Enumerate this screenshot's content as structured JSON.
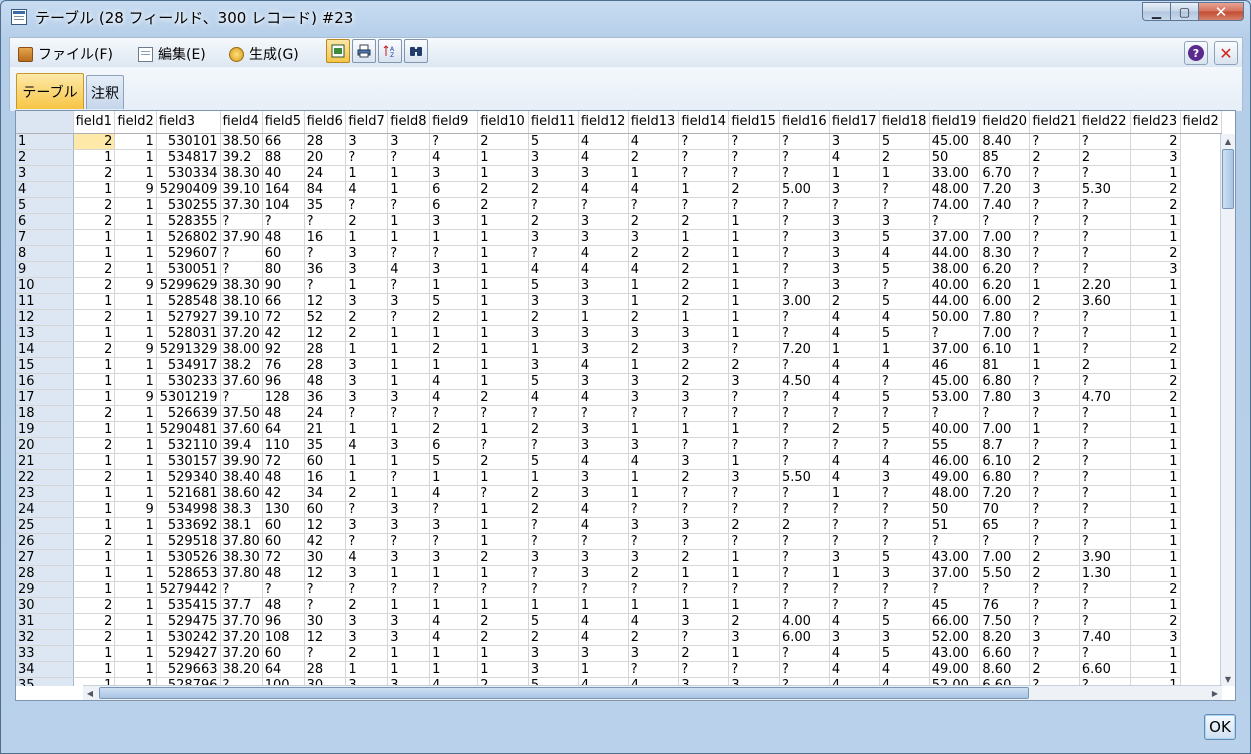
{
  "window": {
    "title": "テーブル (28 フィールド、300 レコード) #23"
  },
  "menu": [
    {
      "label": "ファイル(F)",
      "icon": "folder-icon"
    },
    {
      "label": "編集(E)",
      "icon": "edit-icon"
    },
    {
      "label": "生成(G)",
      "icon": "generate-icon"
    }
  ],
  "tabs": [
    {
      "label": "テーブル",
      "active": true
    },
    {
      "label": "注釈",
      "active": false
    }
  ],
  "columns": [
    "field1",
    "field2",
    "field3",
    "field4",
    "field5",
    "field6",
    "field7",
    "field8",
    "field9",
    "field10",
    "field11",
    "field12",
    "field13",
    "field14",
    "field15",
    "field16",
    "field17",
    "field18",
    "field19",
    "field20",
    "field21",
    "field22",
    "field23",
    "field2"
  ],
  "rows": [
    [
      "1",
      "2",
      "1",
      "530101",
      "38.50",
      "66",
      "28",
      "3",
      "3",
      "?",
      "2",
      "5",
      "4",
      "4",
      "?",
      "?",
      "?",
      "3",
      "5",
      "45.00",
      "8.40",
      "?",
      "?",
      "2"
    ],
    [
      "2",
      "1",
      "1",
      "534817",
      "39.2",
      "88",
      "20",
      "?",
      "?",
      "4",
      "1",
      "3",
      "4",
      "2",
      "?",
      "?",
      "?",
      "4",
      "2",
      "50",
      "85",
      "2",
      "2",
      "3"
    ],
    [
      "3",
      "2",
      "1",
      "530334",
      "38.30",
      "40",
      "24",
      "1",
      "1",
      "3",
      "1",
      "3",
      "3",
      "1",
      "?",
      "?",
      "?",
      "1",
      "1",
      "33.00",
      "6.70",
      "?",
      "?",
      "1"
    ],
    [
      "4",
      "1",
      "9",
      "5290409",
      "39.10",
      "164",
      "84",
      "4",
      "1",
      "6",
      "2",
      "2",
      "4",
      "4",
      "1",
      "2",
      "5.00",
      "3",
      "?",
      "48.00",
      "7.20",
      "3",
      "5.30",
      "2"
    ],
    [
      "5",
      "2",
      "1",
      "530255",
      "37.30",
      "104",
      "35",
      "?",
      "?",
      "6",
      "2",
      "?",
      "?",
      "?",
      "?",
      "?",
      "?",
      "?",
      "?",
      "74.00",
      "7.40",
      "?",
      "?",
      "2"
    ],
    [
      "6",
      "2",
      "1",
      "528355",
      "?",
      "?",
      "?",
      "2",
      "1",
      "3",
      "1",
      "2",
      "3",
      "2",
      "2",
      "1",
      "?",
      "3",
      "3",
      "?",
      "?",
      "?",
      "?",
      "1"
    ],
    [
      "7",
      "1",
      "1",
      "526802",
      "37.90",
      "48",
      "16",
      "1",
      "1",
      "1",
      "1",
      "3",
      "3",
      "3",
      "1",
      "1",
      "?",
      "3",
      "5",
      "37.00",
      "7.00",
      "?",
      "?",
      "1"
    ],
    [
      "8",
      "1",
      "1",
      "529607",
      "?",
      "60",
      "?",
      "3",
      "?",
      "?",
      "1",
      "?",
      "4",
      "2",
      "2",
      "1",
      "?",
      "3",
      "4",
      "44.00",
      "8.30",
      "?",
      "?",
      "2"
    ],
    [
      "9",
      "2",
      "1",
      "530051",
      "?",
      "80",
      "36",
      "3",
      "4",
      "3",
      "1",
      "4",
      "4",
      "4",
      "2",
      "1",
      "?",
      "3",
      "5",
      "38.00",
      "6.20",
      "?",
      "?",
      "3"
    ],
    [
      "10",
      "2",
      "9",
      "5299629",
      "38.30",
      "90",
      "?",
      "1",
      "?",
      "1",
      "1",
      "5",
      "3",
      "1",
      "2",
      "1",
      "?",
      "3",
      "?",
      "40.00",
      "6.20",
      "1",
      "2.20",
      "1"
    ],
    [
      "11",
      "1",
      "1",
      "528548",
      "38.10",
      "66",
      "12",
      "3",
      "3",
      "5",
      "1",
      "3",
      "3",
      "1",
      "2",
      "1",
      "3.00",
      "2",
      "5",
      "44.00",
      "6.00",
      "2",
      "3.60",
      "1"
    ],
    [
      "12",
      "2",
      "1",
      "527927",
      "39.10",
      "72",
      "52",
      "2",
      "?",
      "2",
      "1",
      "2",
      "1",
      "2",
      "1",
      "1",
      "?",
      "4",
      "4",
      "50.00",
      "7.80",
      "?",
      "?",
      "1"
    ],
    [
      "13",
      "1",
      "1",
      "528031",
      "37.20",
      "42",
      "12",
      "2",
      "1",
      "1",
      "1",
      "3",
      "3",
      "3",
      "3",
      "1",
      "?",
      "4",
      "5",
      "?",
      "7.00",
      "?",
      "?",
      "1"
    ],
    [
      "14",
      "2",
      "9",
      "5291329",
      "38.00",
      "92",
      "28",
      "1",
      "1",
      "2",
      "1",
      "1",
      "3",
      "2",
      "3",
      "?",
      "7.20",
      "1",
      "1",
      "37.00",
      "6.10",
      "1",
      "?",
      "2"
    ],
    [
      "15",
      "1",
      "1",
      "534917",
      "38.2",
      "76",
      "28",
      "3",
      "1",
      "1",
      "1",
      "3",
      "4",
      "1",
      "2",
      "2",
      "?",
      "4",
      "4",
      "46",
      "81",
      "1",
      "2",
      "1"
    ],
    [
      "16",
      "1",
      "1",
      "530233",
      "37.60",
      "96",
      "48",
      "3",
      "1",
      "4",
      "1",
      "5",
      "3",
      "3",
      "2",
      "3",
      "4.50",
      "4",
      "?",
      "45.00",
      "6.80",
      "?",
      "?",
      "2"
    ],
    [
      "17",
      "1",
      "9",
      "5301219",
      "?",
      "128",
      "36",
      "3",
      "3",
      "4",
      "2",
      "4",
      "4",
      "3",
      "3",
      "?",
      "?",
      "4",
      "5",
      "53.00",
      "7.80",
      "3",
      "4.70",
      "2"
    ],
    [
      "18",
      "2",
      "1",
      "526639",
      "37.50",
      "48",
      "24",
      "?",
      "?",
      "?",
      "?",
      "?",
      "?",
      "?",
      "?",
      "?",
      "?",
      "?",
      "?",
      "?",
      "?",
      "?",
      "?",
      "1"
    ],
    [
      "19",
      "1",
      "1",
      "5290481",
      "37.60",
      "64",
      "21",
      "1",
      "1",
      "2",
      "1",
      "2",
      "3",
      "1",
      "1",
      "1",
      "?",
      "2",
      "5",
      "40.00",
      "7.00",
      "1",
      "?",
      "1"
    ],
    [
      "20",
      "2",
      "1",
      "532110",
      "39.4",
      "110",
      "35",
      "4",
      "3",
      "6",
      "?",
      "?",
      "3",
      "3",
      "?",
      "?",
      "?",
      "?",
      "?",
      "55",
      "8.7",
      "?",
      "?",
      "1"
    ],
    [
      "21",
      "1",
      "1",
      "530157",
      "39.90",
      "72",
      "60",
      "1",
      "1",
      "5",
      "2",
      "5",
      "4",
      "4",
      "3",
      "1",
      "?",
      "4",
      "4",
      "46.00",
      "6.10",
      "2",
      "?",
      "1"
    ],
    [
      "22",
      "2",
      "1",
      "529340",
      "38.40",
      "48",
      "16",
      "1",
      "?",
      "1",
      "1",
      "1",
      "3",
      "1",
      "2",
      "3",
      "5.50",
      "4",
      "3",
      "49.00",
      "6.80",
      "?",
      "?",
      "1"
    ],
    [
      "23",
      "1",
      "1",
      "521681",
      "38.60",
      "42",
      "34",
      "2",
      "1",
      "4",
      "?",
      "2",
      "3",
      "1",
      "?",
      "?",
      "?",
      "1",
      "?",
      "48.00",
      "7.20",
      "?",
      "?",
      "1"
    ],
    [
      "24",
      "1",
      "9",
      "534998",
      "38.3",
      "130",
      "60",
      "?",
      "3",
      "?",
      "1",
      "2",
      "4",
      "?",
      "?",
      "?",
      "?",
      "?",
      "?",
      "50",
      "70",
      "?",
      "?",
      "1"
    ],
    [
      "25",
      "1",
      "1",
      "533692",
      "38.1",
      "60",
      "12",
      "3",
      "3",
      "3",
      "1",
      "?",
      "4",
      "3",
      "3",
      "2",
      "2",
      "?",
      "?",
      "51",
      "65",
      "?",
      "?",
      "1"
    ],
    [
      "26",
      "2",
      "1",
      "529518",
      "37.80",
      "60",
      "42",
      "?",
      "?",
      "?",
      "1",
      "?",
      "?",
      "?",
      "?",
      "?",
      "?",
      "?",
      "?",
      "?",
      "?",
      "?",
      "?",
      "1"
    ],
    [
      "27",
      "1",
      "1",
      "530526",
      "38.30",
      "72",
      "30",
      "4",
      "3",
      "3",
      "2",
      "3",
      "3",
      "3",
      "2",
      "1",
      "?",
      "3",
      "5",
      "43.00",
      "7.00",
      "2",
      "3.90",
      "1"
    ],
    [
      "28",
      "1",
      "1",
      "528653",
      "37.80",
      "48",
      "12",
      "3",
      "1",
      "1",
      "1",
      "?",
      "3",
      "2",
      "1",
      "1",
      "?",
      "1",
      "3",
      "37.00",
      "5.50",
      "2",
      "1.30",
      "1"
    ],
    [
      "29",
      "1",
      "1",
      "5279442",
      "?",
      "?",
      "?",
      "?",
      "?",
      "?",
      "?",
      "?",
      "?",
      "?",
      "?",
      "?",
      "?",
      "?",
      "?",
      "?",
      "?",
      "?",
      "?",
      "2"
    ],
    [
      "30",
      "2",
      "1",
      "535415",
      "37.7",
      "48",
      "?",
      "2",
      "1",
      "1",
      "1",
      "1",
      "1",
      "1",
      "1",
      "1",
      "?",
      "?",
      "?",
      "45",
      "76",
      "?",
      "?",
      "1"
    ],
    [
      "31",
      "2",
      "1",
      "529475",
      "37.70",
      "96",
      "30",
      "3",
      "3",
      "4",
      "2",
      "5",
      "4",
      "4",
      "3",
      "2",
      "4.00",
      "4",
      "5",
      "66.00",
      "7.50",
      "?",
      "?",
      "2"
    ],
    [
      "32",
      "2",
      "1",
      "530242",
      "37.20",
      "108",
      "12",
      "3",
      "3",
      "4",
      "2",
      "2",
      "4",
      "2",
      "?",
      "3",
      "6.00",
      "3",
      "3",
      "52.00",
      "8.20",
      "3",
      "7.40",
      "3"
    ],
    [
      "33",
      "1",
      "1",
      "529427",
      "37.20",
      "60",
      "?",
      "2",
      "1",
      "1",
      "1",
      "3",
      "3",
      "3",
      "2",
      "1",
      "?",
      "4",
      "5",
      "43.00",
      "6.60",
      "?",
      "?",
      "1"
    ],
    [
      "34",
      "1",
      "1",
      "529663",
      "38.20",
      "64",
      "28",
      "1",
      "1",
      "1",
      "1",
      "3",
      "1",
      "?",
      "?",
      "?",
      "?",
      "4",
      "4",
      "49.00",
      "8.60",
      "2",
      "6.60",
      "1"
    ],
    [
      "35",
      "1",
      "1",
      "528796",
      "?",
      "100",
      "30",
      "3",
      "3",
      "4",
      "2",
      "5",
      "4",
      "4",
      "3",
      "3",
      "?",
      "4",
      "4",
      "52.00",
      "6.60",
      "?",
      "?",
      "1"
    ]
  ],
  "ok_label": "OK"
}
